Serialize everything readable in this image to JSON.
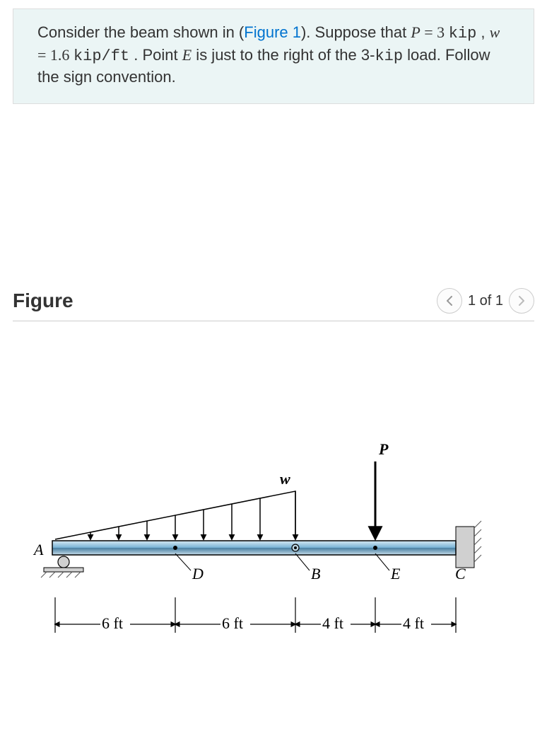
{
  "problem": {
    "pre": "Consider the beam shown in (",
    "figref": "Figure 1",
    "post1": "). Suppose that ",
    "P_sym": "P",
    "eq1": " = 3  ",
    "kip": "kip",
    "sep": " , ",
    "w_sym": "w",
    "eq2": " = 1.6  ",
    "unit2": "kip/ft",
    "post2": " . Point ",
    "E_sym": "E",
    "post3": " is just to the right of the 3-",
    "kip2": "kip",
    "post4": " load. Follow the sign convention."
  },
  "figure": {
    "heading": "Figure",
    "pager": "1 of 1",
    "labels": {
      "A": "A",
      "D": "D",
      "B": "B",
      "E": "E",
      "C": "C",
      "P": "P",
      "w": "w"
    },
    "dims": {
      "d1": "6 ft",
      "d2": "6 ft",
      "d3": "4 ft",
      "d4": "4 ft"
    }
  },
  "chart_data": {
    "type": "diagram",
    "description": "Simply supported/roller + fixed-wall beam with triangular distributed load w over span A-B and point load P between B and C",
    "P_kip": 3,
    "w_kip_per_ft": 1.6,
    "segments": [
      {
        "from": "A",
        "to": "D",
        "length_ft": 6
      },
      {
        "from": "D",
        "to": "B",
        "length_ft": 6
      },
      {
        "from": "B",
        "to": "E",
        "length_ft": 4
      },
      {
        "from": "E",
        "to": "C",
        "length_ft": 4
      }
    ],
    "supports": {
      "A": "roller",
      "C": "fixed-wall"
    },
    "notes": "Point E is just to the right of the 3-kip load."
  }
}
